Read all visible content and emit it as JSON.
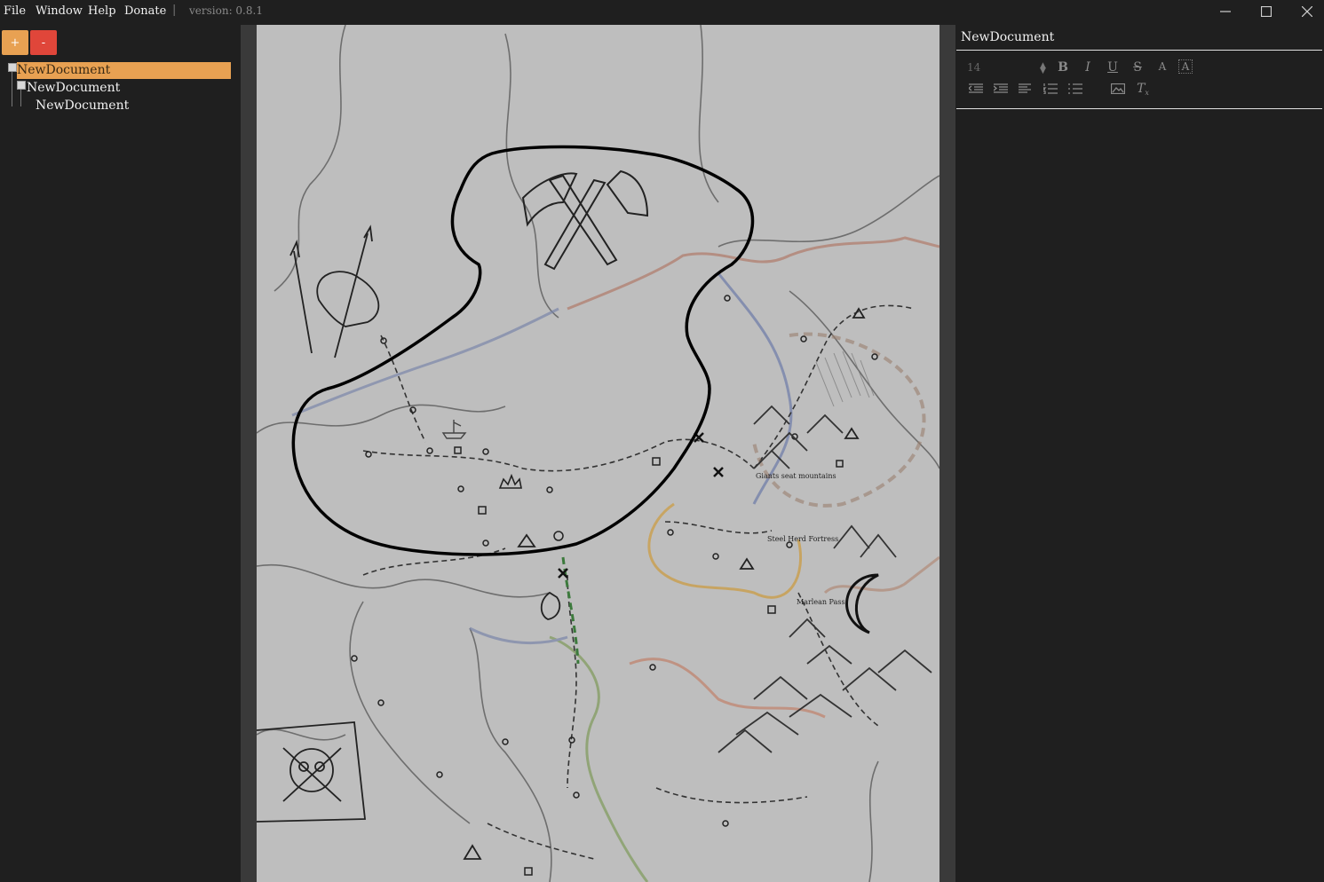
{
  "menu": {
    "file": "File",
    "window": "Window",
    "help": "Help",
    "donate": "Donate",
    "separator": "|",
    "version": "version: 0.8.1"
  },
  "window_controls": {
    "minimize": "minimize-icon",
    "maximize": "maximize-icon",
    "close": "close-icon"
  },
  "tree_controls": {
    "add": "+",
    "remove": "-"
  },
  "tree": {
    "items": [
      {
        "label": "NewDocument",
        "selected": true
      },
      {
        "label": "NewDocument",
        "selected": false
      },
      {
        "label": "NewDocument",
        "selected": false
      }
    ]
  },
  "map": {
    "labels": {
      "giants": "Giants seat mountains",
      "fortress": "Steel Herd Fortress",
      "pass": "Marlean Pass"
    }
  },
  "editor": {
    "title": "NewDocument",
    "font_size": "14",
    "toolbar": {
      "bold": "B",
      "italic": "I",
      "underline": "U",
      "strike": "S",
      "color": "A",
      "highlight": "A",
      "clear": "T"
    }
  },
  "colors": {
    "accent": "#e8a152",
    "remove": "#e0463a",
    "map_bg": "#bebebe",
    "panel": "#1f1f1f"
  }
}
